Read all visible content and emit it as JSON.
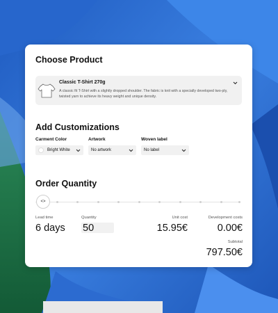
{
  "choose_product": {
    "heading": "Choose Product",
    "product_title": "Classic T-Shirt 270g",
    "product_desc": "A classic fit T-Shirt with a slightly dropped shoulder. The fabric is knit with a specially developed two-ply, twisted yarn to achieve its heavy weight and unique density.",
    "icons": {
      "shirt": "tshirt-icon",
      "expand": "chevron-down-icon"
    }
  },
  "customizations": {
    "heading": "Add Customizations",
    "garment_color_label": "Carment Color",
    "garment_color_value": "Bright White",
    "garment_color_swatch": "#ffffff",
    "artwork_label": "Artwork",
    "artwork_value": "No artwork",
    "woven_label_label": "Woven label",
    "woven_label_value": "No label"
  },
  "order": {
    "heading": "Order Quantity",
    "slider_icon": "<>",
    "lead_time_label": "Lead time",
    "lead_time_value": "6 days",
    "quantity_label": "Quantity",
    "quantity_value": "50",
    "unit_cost_label": "Unit cost",
    "unit_cost_value": "15.95€",
    "dev_costs_label": "Development costs",
    "dev_costs_value": "0.00€",
    "subtotal_label": "Subtotal",
    "subtotal_value": "797.50€"
  },
  "colors": {
    "background_fabric": "#2f6ed3",
    "green_fabric": "#1f7a4d",
    "card": "#ffffff",
    "field_bg": "#f1f1f1"
  }
}
